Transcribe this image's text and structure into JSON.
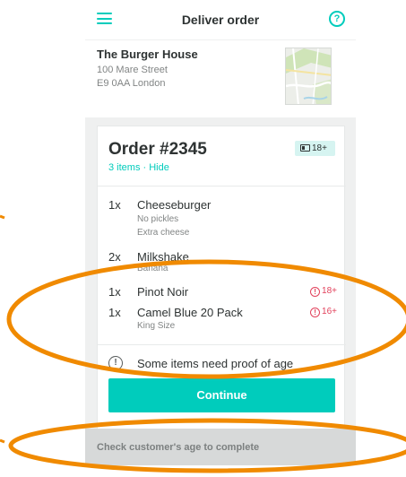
{
  "header": {
    "title": "Deliver order",
    "menu_icon": "hamburger-menu-icon",
    "help_icon": "question-circle-icon",
    "help_glyph": "?",
    "accent": "#00ccbc"
  },
  "restaurant": {
    "name": "The Burger House",
    "address_line1": "100 Mare Street",
    "address_line2": "E9 0AA London",
    "map_icon": "map-thumbnail"
  },
  "order": {
    "title": "Order #2345",
    "items_toggle": "3 items · Hide",
    "age_badge": "18+",
    "age_badge_icon": "id-card-icon",
    "items": [
      {
        "qty": "1x",
        "name": "Cheeseburger",
        "modifiers": [
          "No pickles",
          "Extra cheese"
        ],
        "age": ""
      },
      {
        "qty": "2x",
        "name": "Milkshake",
        "modifiers": [
          "Banana"
        ],
        "age": ""
      },
      {
        "qty": "1x",
        "name": "Pinot Noir",
        "modifiers": [],
        "age": "18+"
      },
      {
        "qty": "1x",
        "name": "Camel Blue 20 Pack",
        "modifiers": [
          "King Size"
        ],
        "age": "16+"
      }
    ],
    "warning_color": "#e2425c",
    "notice": "Some items need proof of age",
    "notice_icon": "info-circle-icon",
    "notice_glyph": "!",
    "continue_label": "Continue"
  },
  "footer": {
    "text": "Check customer's age to complete"
  },
  "annotations": {
    "ellipse_color": "#f08a00"
  }
}
